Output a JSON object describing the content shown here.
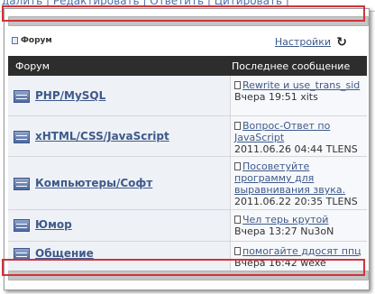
{
  "top_links": "далить | Редактировать | Ответить | Цитировать |",
  "toolbar": {
    "forum_label": "Форум",
    "settings_label": "Настройки",
    "refresh_icon": "refresh-icon"
  },
  "table": {
    "headers": {
      "forum": "Форум",
      "last_post": "Последнее сообщение"
    },
    "rows": [
      {
        "forum": "PHP/MySQL",
        "post_title": "Rewrite и use_trans_sid",
        "post_meta": "Вчера 19:51 xits"
      },
      {
        "forum": "xHTML/CSS/JavaScript",
        "post_title": "Вопрос-Ответ по JavaScript",
        "post_meta": "2011.06.26 04:44 TLENS"
      },
      {
        "forum": "Компьютеры/Софт",
        "post_title": "Посоветуйте программу для выравнивания звука.",
        "post_meta": "2011.06.22 20:35 TLENS"
      },
      {
        "forum": "Юмор",
        "post_title": "Чел терь крутой",
        "post_meta": "Вчера 13:27 Nu3oN"
      },
      {
        "forum": "Общение",
        "post_title": "помогайте ддосят ппц",
        "post_meta": "Вчера 16:42 wexe"
      }
    ]
  },
  "colors": {
    "header_bg": "#2d2d2d",
    "link": "#3e5a8a",
    "highlight": "#d0333b"
  }
}
